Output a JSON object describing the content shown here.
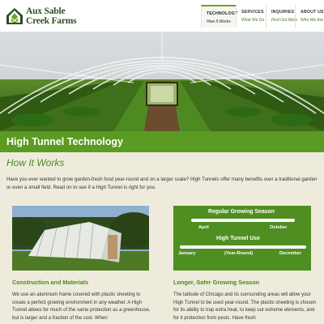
{
  "brand": {
    "line1": "Aux Sable",
    "line2": "Creek Farms",
    "logo_icon": "barn-icon",
    "color": "#2f4f1f"
  },
  "nav": [
    {
      "label": "TECHNOLOGY",
      "sub": "How It Works",
      "active": true
    },
    {
      "label": "SERVICES",
      "sub": "What We Do"
    },
    {
      "label": "INQUIRIES",
      "sub": "Find Out More"
    },
    {
      "label": "ABOUT US",
      "sub": "Who We Are"
    }
  ],
  "page": {
    "title": "High Tunnel Technology",
    "subtitle": "How It Works",
    "intro": "Have you ever wanted to grow garden-fresh food year-round and on a larger scale? High Tunnels offer many benefits over a traditional garden or even a small field. Read on to see if a High Tunnel is right for you."
  },
  "season_panel": {
    "regular_title": "Regular Growing Season",
    "regular_start": "April",
    "regular_end": "October",
    "tunnel_title": "High Tunnel Use",
    "tunnel_start": "January",
    "tunnel_mid": "(Year-Round)",
    "tunnel_end": "December"
  },
  "sections": [
    {
      "heading": "Construction and Materials",
      "body": "We use an aluminum frame covered with plastic sheeting to create a perfect growing environment in any weather. A High Tunnel allows for much of the same protection as a greenhouse, but is larger and a fraction of the cost. When"
    },
    {
      "heading": "Longer, Safer Growing Season",
      "body": "The latitude of Chicago and its surrounding areas will allow your High Tunnel to be used year-round. The plastic sheeting is chosen for its ability to trap extra heat, to keep out extreme elements, and for it protection from pests. Have fresh"
    }
  ],
  "colors": {
    "accent": "#5b9a23",
    "panel": "#4f8f22",
    "content_bg": "#eeebdc",
    "heading": "#4b8a1f"
  }
}
